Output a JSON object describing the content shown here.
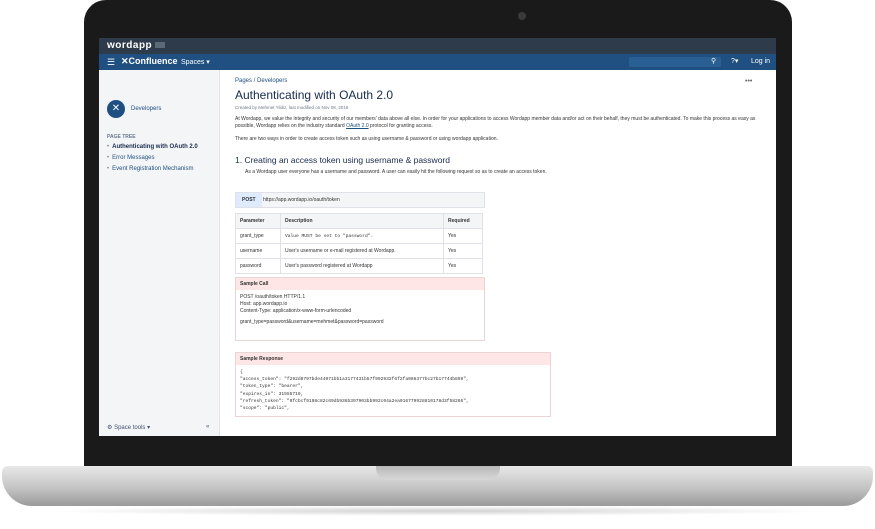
{
  "app": {
    "brand": "wordapp",
    "product": "Confluence",
    "spaces_menu": "Spaces ▾",
    "help": "?▾",
    "login": "Log in"
  },
  "sidebar": {
    "space_name": "Developers",
    "page_tree_heading": "PAGE TREE",
    "items": [
      {
        "label": "Authenticating with OAuth 2.0",
        "active": true
      },
      {
        "label": "Error Messages",
        "active": false
      },
      {
        "label": "Event Registration Mechanism",
        "active": false
      }
    ],
    "space_tools": "Space tools ▾",
    "collapse": "«"
  },
  "page": {
    "breadcrumb_pages": "Pages",
    "breadcrumb_sep": " / ",
    "breadcrumb_space": "Developers",
    "more": "•••",
    "title": "Authenticating with OAuth 2.0",
    "byline": "Created by Mehmet Yildiz, last modified on Nov 08, 2016",
    "intro_1a": "At Wordapp, we value the integrity and security of our members' data above all else.  In order for your applications to access Wordapp member data and/or act on their behalf, they must be authenticated.  To make this process as easy as possible, Wordapp relies on the industry standard ",
    "intro_link": "OAuth 2.0",
    "intro_1b": " protocol for granting access.",
    "intro_2": "There are two ways in order to create access token such as using username & password or using wordapp application.",
    "section_title": "1. Creating an access token using username & password",
    "section_text": "As a Wordapp user everyone has a username and password. A user can easily hit the following request so as to create an access token.",
    "post_method": "POST",
    "post_url": "https://app.wordapp.io/oauth/token",
    "param_table": {
      "headers": [
        "Parameter",
        "Description",
        "Required"
      ],
      "rows": [
        [
          "grant_type",
          "Value MUST be set to \"password\".",
          "Yes"
        ],
        [
          "username",
          "User's username or e-mail registered at Wordapp.",
          "Yes"
        ],
        [
          "password",
          "User's password registered at Wordapp",
          "Yes"
        ]
      ]
    },
    "sample_call": {
      "heading": "Sample Call",
      "lines": [
        "POST /oauth/token HTTP/1.1",
        "Host: app.wordapp.io",
        "Content-Type: application/x-www-form-urlencoded",
        "grant_type=password&username=mehmet&password=password"
      ]
    },
    "sample_response": {
      "heading": "Sample Response",
      "lines": [
        "{",
        "  \"access_token\": \"f292d8797bde44071bb1a3177431b57f992932f6f2fa086377bc27b17744b859\",",
        "  \"token_type\": \"bearer\",",
        "  \"expires_in\": 31555719,",
        "  \"refresh_token\": \"0fcbcf9198c82c69db936b397903bb992c04a2ea016779928810178d3f58266\",",
        "  \"scope\": \"public\","
      ]
    }
  }
}
